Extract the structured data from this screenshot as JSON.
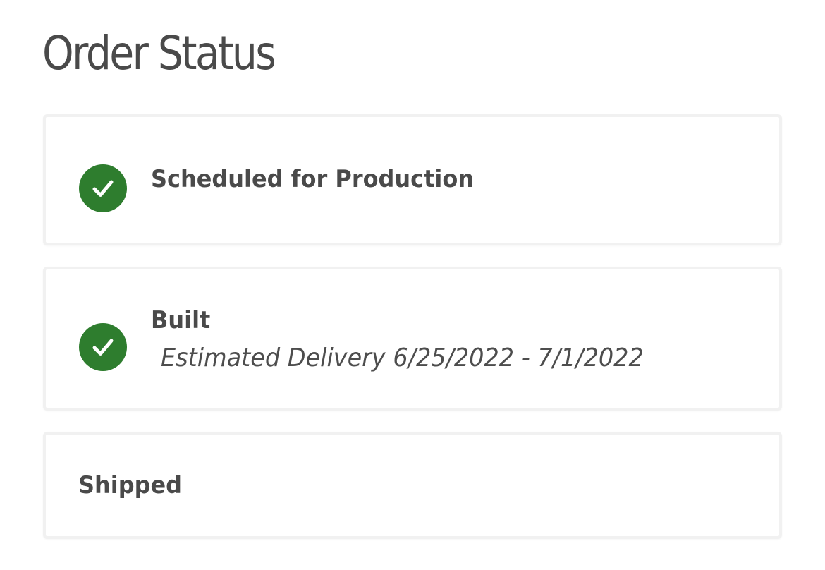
{
  "page": {
    "title": "Order Status"
  },
  "colors": {
    "complete": "#2e7d2e",
    "text": "#4a4a4a",
    "card_border": "#f1f1f1"
  },
  "steps": [
    {
      "label": "Scheduled for Production",
      "status": "complete",
      "icon": "check-circle-icon",
      "detail": ""
    },
    {
      "label": "Built",
      "status": "complete",
      "icon": "check-circle-icon",
      "detail": "Estimated Delivery 6/25/2022 - 7/1/2022"
    },
    {
      "label": "Shipped",
      "status": "pending",
      "icon": "",
      "detail": ""
    }
  ]
}
